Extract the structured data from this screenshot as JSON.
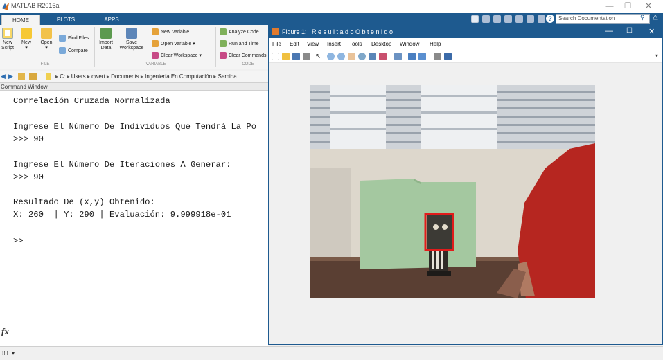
{
  "app": {
    "title": "MATLAB R2016a"
  },
  "ribbon": {
    "tabs": [
      {
        "label": "HOME"
      },
      {
        "label": "PLOTS"
      },
      {
        "label": "APPS"
      }
    ],
    "search_placeholder": "Search Documentation",
    "file_section": "FILE",
    "variable_section": "VARIABLE",
    "code_section": "CODE",
    "new_script": [
      "New",
      "Script"
    ],
    "new": "New",
    "open": "Open",
    "find_files": "Find Files",
    "compare": "Compare",
    "import_data": [
      "Import",
      "Data"
    ],
    "save_workspace": [
      "Save",
      "Workspace"
    ],
    "new_variable": "New Variable",
    "open_variable": "Open Variable ▾",
    "clear_workspace": "Clear Workspace ▾",
    "analyze_code": "Analyze Code",
    "run_and_time": "Run and Time",
    "clear_commands": "Clear Commands"
  },
  "path": {
    "crumbs": [
      "C:",
      "Users",
      "qwert",
      "Documents",
      "Ingeniería En Computación",
      "Semina"
    ]
  },
  "command_window": {
    "label": "Command Window",
    "lines": [
      "Correlación Cruzada Normalizada",
      "",
      "Ingrese El Número De Individuos Que Tendrá La Po",
      ">>> 90",
      "",
      "Ingrese El Número De Iteraciones A Generar:",
      ">>> 90",
      "",
      "Resultado De (x,y) Obtenido:",
      "X: 260  | Y: 290 | Evaluación: 9.999918e-01",
      "",
      ">>"
    ],
    "fx": "fx"
  },
  "figure": {
    "title_prefix": "Figure 1:",
    "title": "R e s u l t a d o   O b t e n i d o",
    "menu": [
      "File",
      "Edit",
      "View",
      "Insert",
      "Tools",
      "Desktop",
      "Window",
      "Help"
    ],
    "detection_box_color": "#e21b1b",
    "image_note_colors": {
      "folder": "#a4c8a0",
      "shirt": "#b62620",
      "desk": "#5a3f33"
    }
  },
  "status": {
    "text": "!!!!"
  }
}
